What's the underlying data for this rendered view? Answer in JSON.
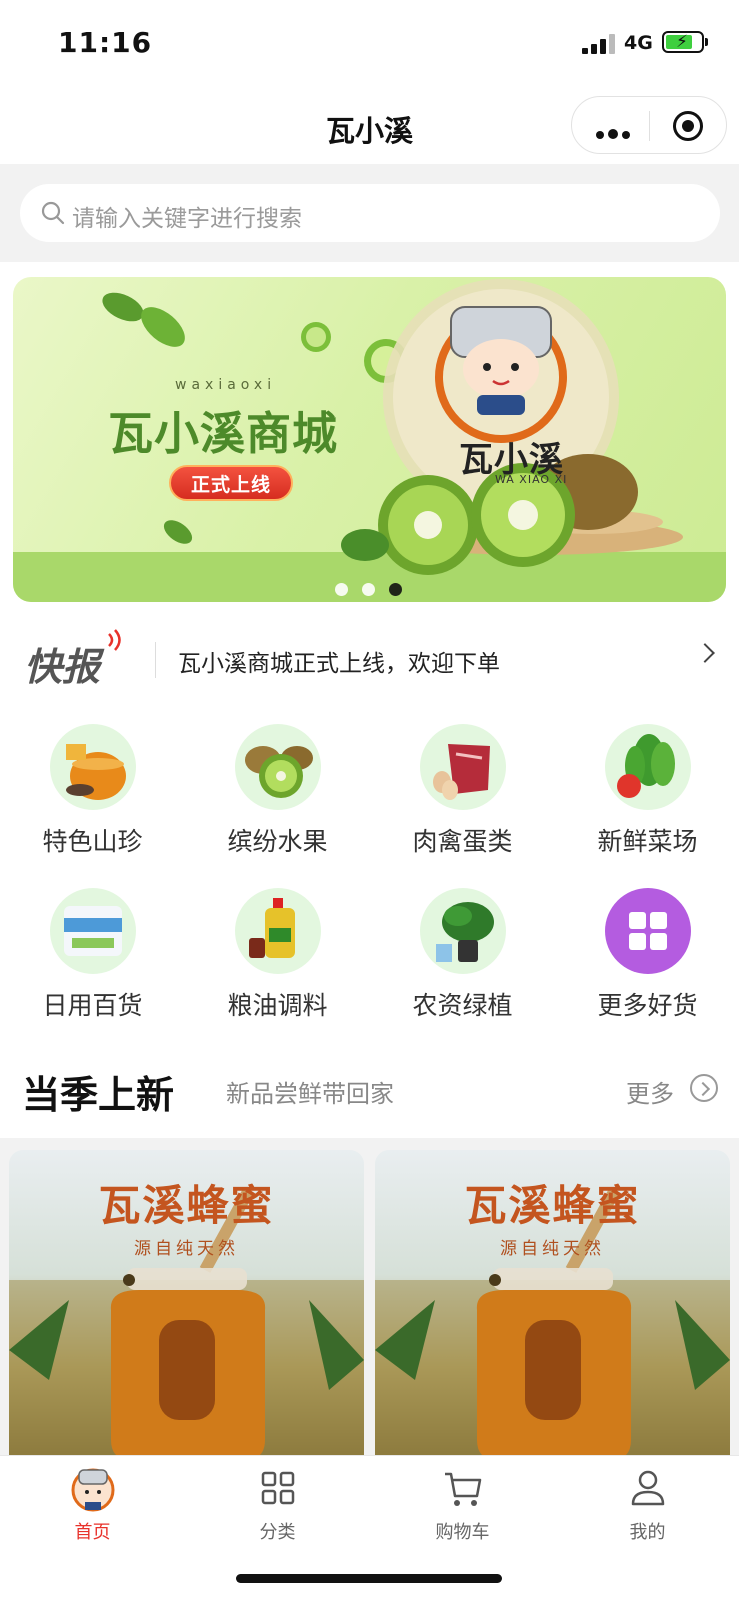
{
  "status_bar": {
    "time": "11:16",
    "network": "4G"
  },
  "nav": {
    "title": "瓦小溪"
  },
  "search": {
    "placeholder": "请输入关键字进行搜索"
  },
  "banner": {
    "subtitle": "waxiaoxi",
    "title": "瓦小溪商城",
    "tag": "正式上线",
    "logo_name": "瓦小溪",
    "logo_en": "WA XIAO XI",
    "active_slide": 3,
    "slide_count": 3
  },
  "news": {
    "brand": "快报",
    "text": "瓦小溪商城正式上线，欢迎下单"
  },
  "categories": [
    {
      "label": "特色山珍",
      "icon": "honey-icon"
    },
    {
      "label": "缤纷水果",
      "icon": "kiwi-icon"
    },
    {
      "label": "肉禽蛋类",
      "icon": "meat-icon"
    },
    {
      "label": "新鲜菜场",
      "icon": "vegetable-icon"
    },
    {
      "label": "日用百货",
      "icon": "tissue-icon"
    },
    {
      "label": "粮油调料",
      "icon": "oil-icon"
    },
    {
      "label": "农资绿植",
      "icon": "plant-icon"
    },
    {
      "label": "更多好货",
      "icon": "grid-icon"
    }
  ],
  "season": {
    "title": "当季上新",
    "subtitle": "新品尝鲜带回家",
    "more": "更多"
  },
  "products": [
    {
      "title": "瓦溪蜂蜜",
      "subtitle": "源自纯天然"
    },
    {
      "title": "瓦溪蜂蜜",
      "subtitle": "源自纯天然"
    }
  ],
  "tabs": [
    {
      "label": "首页",
      "icon": "home-avatar-icon",
      "active": true
    },
    {
      "label": "分类",
      "icon": "grid-icon",
      "active": false
    },
    {
      "label": "购物车",
      "icon": "cart-icon",
      "active": false
    },
    {
      "label": "我的",
      "icon": "user-icon",
      "active": false
    }
  ],
  "colors": {
    "accent": "#e8322b",
    "banner_green": "#4d8a2a",
    "product_title": "#c4551f"
  }
}
